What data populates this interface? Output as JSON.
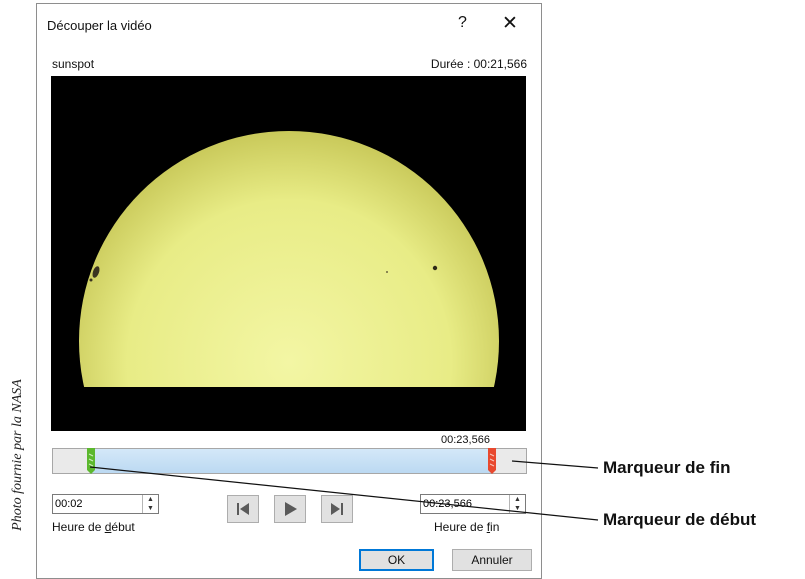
{
  "credit": "Photo fournie par la NASA",
  "dialog": {
    "title": "Découper la vidéo",
    "help_glyph": "?",
    "close_glyph": "✕",
    "video_name": "sunspot",
    "duration": "Durée : 00:21,566",
    "end_marker_time": "00:23,566",
    "start": {
      "value": "00:02",
      "label_before": "Heure de ",
      "label_accel": "d",
      "label_after": "ébut"
    },
    "end": {
      "value": "00:23,566",
      "label_before": "Heure de ",
      "label_accel": "f",
      "label_after": "in"
    },
    "trim": {
      "start_fraction": 0.081,
      "end_fraction": 0.929
    },
    "controls": [
      "previous-frame-icon",
      "play-icon",
      "next-frame-icon"
    ],
    "ok_label": "OK",
    "cancel_label": "Annuler"
  },
  "callouts": {
    "end_marker": "Marqueur de fin",
    "start_marker": "Marqueur de début"
  },
  "colors": {
    "start_marker": "#5cb82e",
    "end_marker": "#e8492f",
    "sun": "#eef292"
  }
}
